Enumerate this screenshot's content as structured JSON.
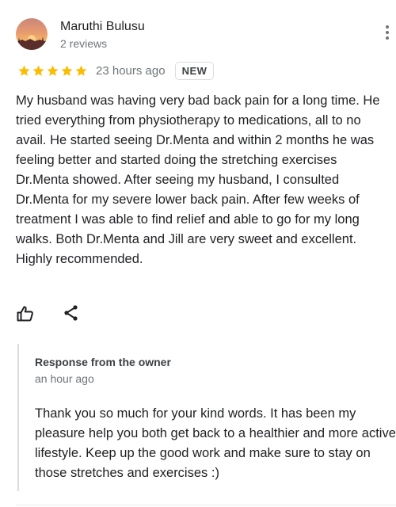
{
  "reviewer": {
    "name": "Maruthi Bulusu",
    "review_count": "2 reviews",
    "avatar": "sunset-photo"
  },
  "menu_icon": "more-vertical-icon",
  "review": {
    "rating": 5,
    "max_rating": 5,
    "time_ago": "23 hours ago",
    "badge": "NEW",
    "text": "My husband was having very bad back pain for a long time. He tried everything from physiotherapy to medications, all to no avail. He started seeing Dr.Menta and within 2 months he was feeling better and started doing the stretching exercises Dr.Menta showed. After seeing my husband, I consulted Dr.Menta for my severe lower back pain. After few weeks of treatment I was able to find relief and able to go for my long walks. Both Dr.Menta and Jill are very sweet and excellent. Highly recommended."
  },
  "actions": {
    "like_icon": "thumbs-up-icon",
    "share_icon": "share-icon"
  },
  "owner_response": {
    "title": "Response from the owner",
    "time_ago": "an hour ago",
    "text": "Thank you so much for your kind words. It has been my pleasure help you both get back to a healthier and more active lifestyle. Keep up the good work and make sure to stay on those stretches and exercises :)"
  },
  "colors": {
    "star": "#fbbc04",
    "primary_text": "#202124",
    "secondary_text": "#70757a",
    "divider": "#dadce0"
  }
}
